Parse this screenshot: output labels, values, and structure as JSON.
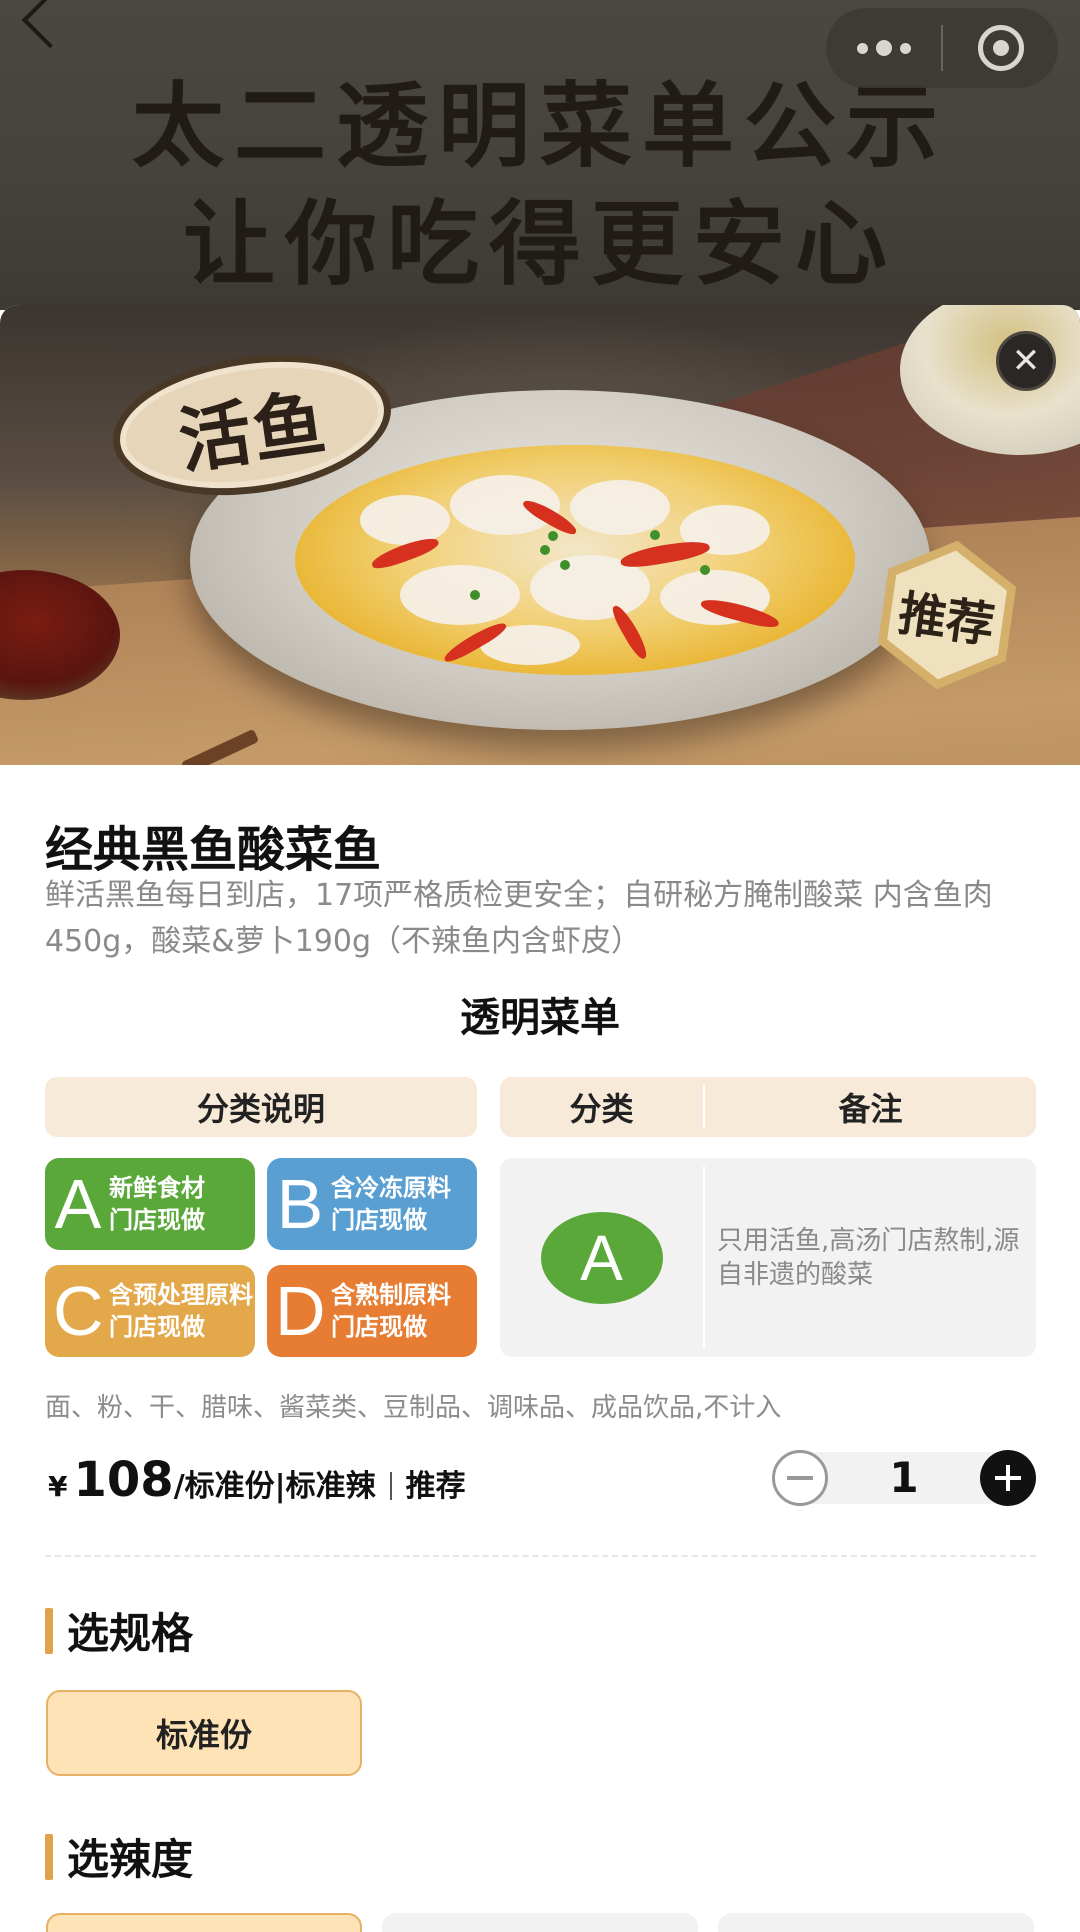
{
  "banner": {
    "line1": "太二透明菜单公示",
    "line2": "让你吃得更安心"
  },
  "hero": {
    "badge_live": "活鱼",
    "badge_recommend": "推荐",
    "close_icon": "✕"
  },
  "product": {
    "name": "经典黑鱼酸菜鱼",
    "description": "鲜活黑鱼每日到店，17项严格质检更安全；自研秘方腌制酸菜 内含鱼肉450g，酸菜&萝卜190g（不辣鱼内含虾皮）"
  },
  "menu": {
    "title": "透明菜单",
    "header_left": "分类说明",
    "header_category": "分类",
    "header_note": "备注",
    "categories": [
      {
        "letter": "A",
        "line1": "新鲜食材",
        "line2": "门店现做",
        "color": "#5aa839"
      },
      {
        "letter": "B",
        "line1": "含冷冻原料",
        "line2": "门店现做",
        "color": "#5a9fd2"
      },
      {
        "letter": "C",
        "line1": "含预处理原料",
        "line2": "门店现做",
        "color": "#e3a84a"
      },
      {
        "letter": "D",
        "line1": "含熟制原料",
        "line2": "门店现做",
        "color": "#e67d33"
      }
    ],
    "item_category": "A",
    "item_note": "只用活鱼,高汤门店熬制,源自非遗的酸菜",
    "footnote": "面、粉、干、腊味、酱菜类、豆制品、调味品、成品饮品,不计入"
  },
  "price": {
    "currency": "¥",
    "amount": "108",
    "spec": "/标准份|标准辣",
    "tag": "推荐",
    "quantity": "1"
  },
  "sections": {
    "spec_title": "选规格",
    "spec_options": [
      "标准份"
    ],
    "spice_title": "选辣度"
  }
}
